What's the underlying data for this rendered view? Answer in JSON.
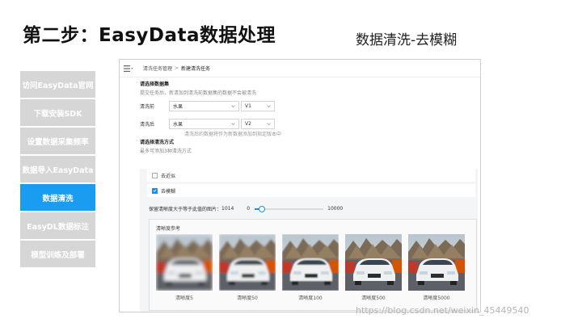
{
  "slide": {
    "title": "第二步：EasyData数据处理",
    "subtitle": "数据清洗-去模糊"
  },
  "steps": [
    {
      "label": "访问EasyData官网",
      "active": false
    },
    {
      "label": "下载安装SDK",
      "active": false
    },
    {
      "label": "设置数据采集频率",
      "active": false
    },
    {
      "label": "数据导入EasyData",
      "active": false
    },
    {
      "label": "数据清洗",
      "active": true
    },
    {
      "label": "EasyDL数据标注",
      "active": false
    },
    {
      "label": "模型训练及部署",
      "active": false
    }
  ],
  "screenshot": {
    "breadcrumb": [
      "清洗任务管理",
      "新建清洗任务"
    ],
    "breadcrumb_sep": ">",
    "section_dataset": "请选择数据集",
    "dataset_hint": "提交任务后，新清加到清洗前数据集的数据不会被清洗",
    "before": {
      "label": "清洗前",
      "dataset": "水果",
      "version": "V1"
    },
    "after": {
      "label": "清洗后",
      "dataset": "水果",
      "version": "V2"
    },
    "after_note": "清洗后的数据将作为新数据添加到指定版本中",
    "section_method": "请选择清洗方式",
    "method_hint": "最多可添加3种清洗方式",
    "options": [
      {
        "label": "去近似",
        "checked": false
      },
      {
        "label": "去模糊",
        "checked": true
      }
    ],
    "threshold": {
      "label": "保留清晰度大于等于此值的图片：",
      "value": 1014,
      "min": 0,
      "max": 10000,
      "min_label": "0",
      "max_label": "10000"
    },
    "reference_title": "清晰度参考",
    "thumbnails": [
      {
        "caption": "清晰度5",
        "blur": 2.2
      },
      {
        "caption": "清晰度50",
        "blur": 1.2
      },
      {
        "caption": "清晰度100",
        "blur": 0.7
      },
      {
        "caption": "清晰度500",
        "blur": 0.3
      },
      {
        "caption": "清晰度5000",
        "blur": 0
      }
    ]
  },
  "watermark": "https://blog.csdn.net/weixin_45449540",
  "colors": {
    "accent": "#1a9cf0",
    "step_inactive": "#d6d6d6"
  }
}
